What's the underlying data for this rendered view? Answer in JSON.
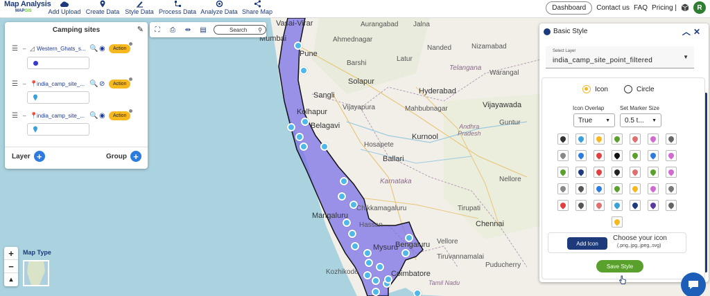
{
  "brand": {
    "title": "Map Analysis",
    "sub_prefix": "MAP",
    "sub_suffix": "GIS"
  },
  "nav": [
    {
      "label": "Add Upload",
      "icon": "cloud-upload-icon"
    },
    {
      "label": "Create Data",
      "icon": "map-pin-icon"
    },
    {
      "label": "Style Data",
      "icon": "brush-icon"
    },
    {
      "label": "Process Data",
      "icon": "process-icon"
    },
    {
      "label": "Analyze Data",
      "icon": "analyze-icon"
    },
    {
      "label": "Share Map",
      "icon": "share-icon"
    }
  ],
  "right_nav": {
    "dashboard": "Dashboard",
    "contact": "Contact us",
    "faq": "FAQ",
    "pricing": "Pricing |",
    "avatar": "R"
  },
  "layer_panel": {
    "title": "Camping sites",
    "layers": [
      {
        "name": "Western_Ghats_s...",
        "type": "polygon",
        "action": "Action",
        "symbol_color": "#3a3ad0",
        "visible": true
      },
      {
        "name": "india_camp_site_...",
        "type": "point",
        "action": "Action",
        "symbol_color": "#3aa0d8",
        "visible": false
      },
      {
        "name": "india_camp_site_...",
        "type": "point",
        "action": "Action",
        "symbol_color": "#3aa0d8",
        "visible": true
      }
    ],
    "layer_label": "Layer",
    "group_label": "Group"
  },
  "map_tools": {
    "search": "Search"
  },
  "map_type": {
    "label": "Map Type"
  },
  "map_labels": {
    "cities": [
      "Vasai-Virar",
      "Mumbai",
      "Pune",
      "Ahmednagar",
      "Aurangabad",
      "Jalna",
      "Nanded",
      "Nizamabad",
      "Latur",
      "Barshi",
      "Solapur",
      "Sangli",
      "Kolhapur",
      "Belagavi",
      "Vijayapura",
      "Hosapete",
      "Ballari",
      "Kurnool",
      "Hyderabad",
      "Telangana",
      "Mahbubnagar",
      "Warangal",
      "Vijayawada",
      "Guntur",
      "Nellore",
      "Chikkamagaluru",
      "Mangaluru",
      "Hassan",
      "Bengaluru",
      "Mysuru",
      "Kozhikode",
      "Coimbatore",
      "Chennai",
      "Puducherry",
      "Tiruvannamalai",
      "Vellore",
      "Tirupati",
      "Tamil Nadu",
      "Karnataka"
    ],
    "region_andhra": "Andhra\nPradesh"
  },
  "style_panel": {
    "title": "Basic Style",
    "select_caption": "Select Layer",
    "selected_layer": "india_camp_site_point_filtered",
    "radio_icon": "Icon",
    "radio_circle": "Circle",
    "icon_overlap_label": "Icon Overlap",
    "icon_overlap_value": "True",
    "marker_size_label": "Set Marker Size",
    "marker_size_value": "0.5 t...",
    "add_icon": "Add Icon",
    "choose_icon": "Choose your icon",
    "choose_icon_types": "(.png,.jpg,.jpeg,.svg)",
    "save": "Save Style",
    "icon_colors": [
      "#333333",
      "#3aa0d8",
      "#f5b81f",
      "#5aa02c",
      "#e07070",
      "#d06ad0",
      "#666666",
      "#888888",
      "#2e7be0",
      "#e04040",
      "#111111",
      "#5aa02c",
      "#2e7be0",
      "#d06ad0",
      "#5aa02c",
      "#1d3a7a",
      "#e04040",
      "#222222",
      "#e07070",
      "#5aa02c",
      "#d06ad0",
      "#888888",
      "#555555",
      "#2e7be0",
      "#5aa02c",
      "#f5b81f",
      "#d06ad0",
      "#777777",
      "#e04040",
      "#555555",
      "#e07070",
      "#3aa0d8",
      "#1d3a7a",
      "#5a3aa0",
      "#666666",
      "#f5b81f"
    ]
  }
}
